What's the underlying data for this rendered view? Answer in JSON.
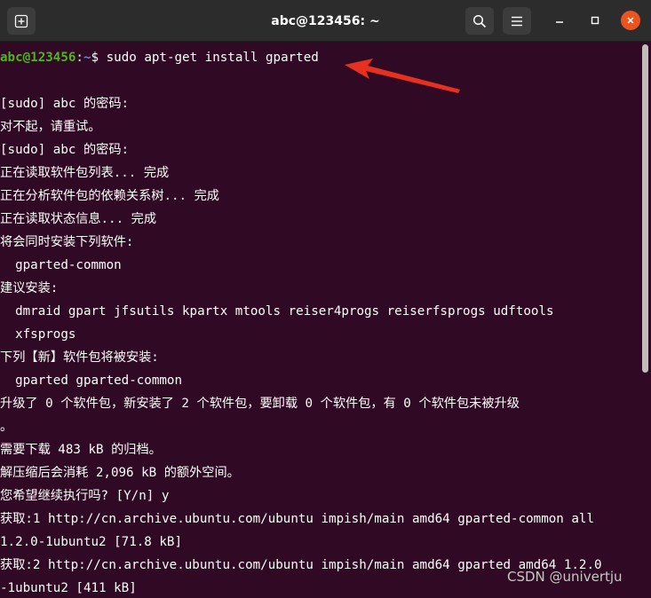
{
  "window": {
    "title": "abc@123456: ~",
    "new_tab_icon": "new-tab-icon",
    "search_icon": "search-icon",
    "menu_icon": "hamburger-menu-icon",
    "minimize_icon": "minimize-icon",
    "maximize_icon": "maximize-icon",
    "close_icon": "close-icon",
    "close_color": "#e95420"
  },
  "terminal": {
    "background": "#300a24",
    "prompt_user": "abc@123456",
    "prompt_sep": ":",
    "prompt_path": "~",
    "prompt_symbol": "$ ",
    "command": "sudo apt-get install gparted",
    "output": [
      "",
      "[sudo] abc 的密码:",
      "对不起，请重试。",
      "[sudo] abc 的密码:",
      "正在读取软件包列表... 完成",
      "正在分析软件包的依赖关系树... 完成",
      "正在读取状态信息... 完成",
      "将会同时安装下列软件:",
      "  gparted-common",
      "建议安装:",
      "  dmraid gpart jfsutils kpartx mtools reiser4progs reiserfsprogs udftools",
      "  xfsprogs",
      "下列【新】软件包将被安装:",
      "  gparted gparted-common",
      "升级了 0 个软件包，新安装了 2 个软件包，要卸载 0 个软件包，有 0 个软件包未被升级",
      "。",
      "需要下载 483 kB 的归档。",
      "解压缩后会消耗 2,096 kB 的额外空间。",
      "您希望继续执行吗? [Y/n] y",
      "获取:1 http://cn.archive.ubuntu.com/ubuntu impish/main amd64 gparted-common all",
      "1.2.0-1ubuntu2 [71.8 kB]",
      "获取:2 http://cn.archive.ubuntu.com/ubuntu impish/main amd64 gparted amd64 1.2.0",
      "-1ubuntu2 [411 kB]"
    ]
  },
  "annotation": {
    "arrow_color": "#e8301e"
  },
  "watermark": "CSDN @univertju"
}
